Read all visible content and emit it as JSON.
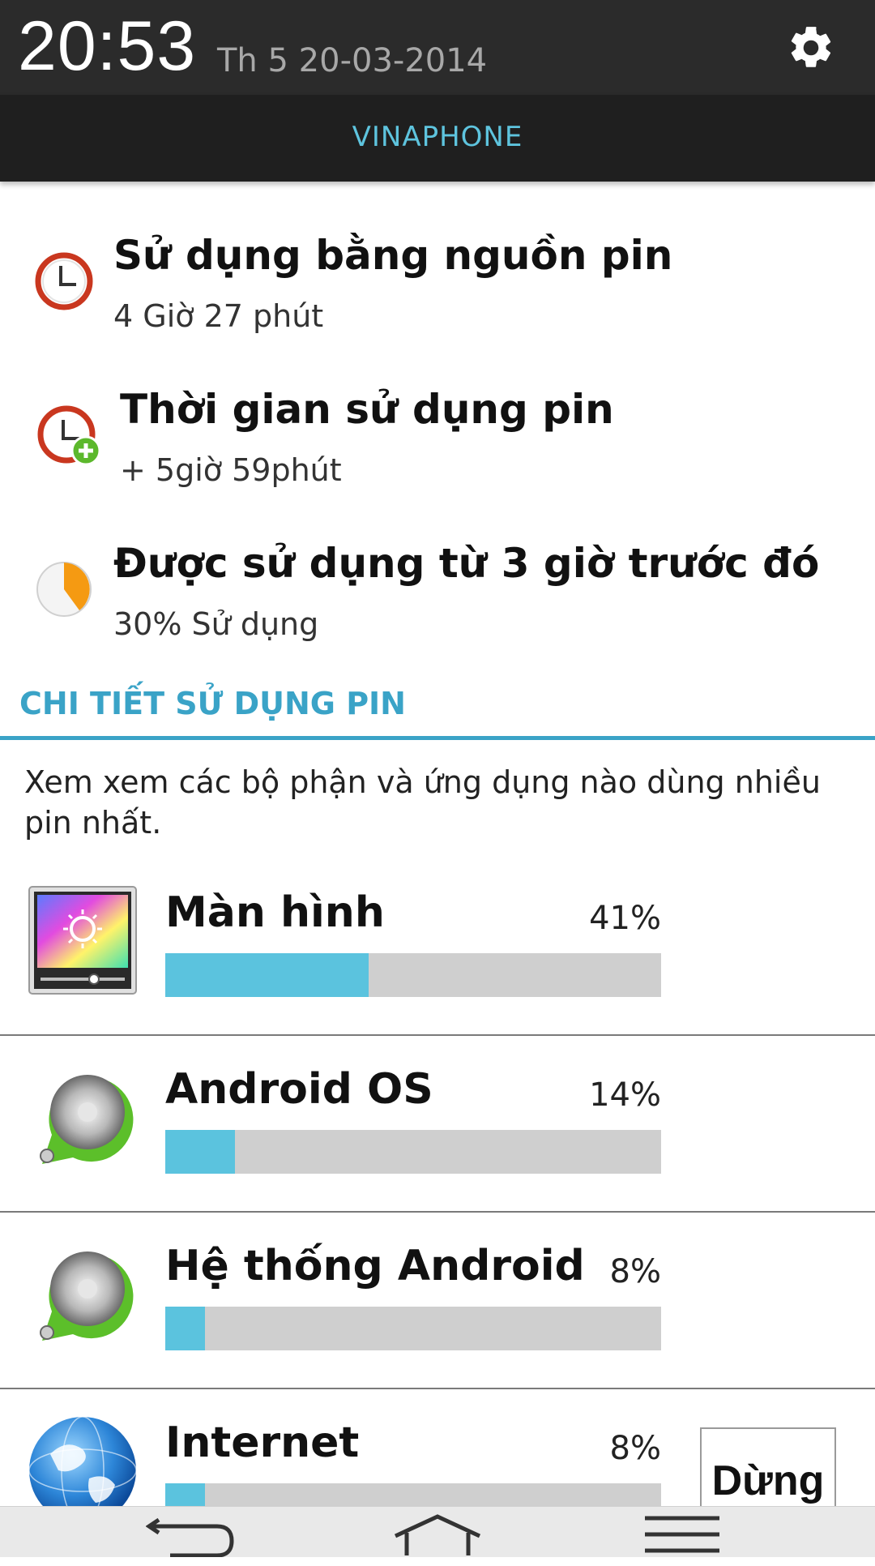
{
  "status": {
    "time": "20:53",
    "date": "Th 5 20-03-2014",
    "carrier": "VINAPHONE"
  },
  "summary": [
    {
      "title": "Sử dụng bằng nguồn pin",
      "subtitle": "4 Giờ 27 phút"
    },
    {
      "title": "Thời gian sử dụng pin",
      "subtitle": "+ 5giờ 59phút"
    },
    {
      "title": "Được sử dụng từ 3 giờ trước đó",
      "subtitle": "30% Sử dụng"
    }
  ],
  "section": {
    "title": "CHI TIẾT SỬ DỤNG PIN",
    "description": "Xem xem các bộ phận và ứng dụng nào dùng nhiều pin nhất."
  },
  "usage": [
    {
      "name": "Màn hình",
      "percent_label": "41%",
      "percent": 41,
      "icon": "display-icon"
    },
    {
      "name": "Android OS",
      "percent_label": "14%",
      "percent": 14,
      "icon": "android-os-icon"
    },
    {
      "name": "Hệ thống Android",
      "percent_label": "8%",
      "percent": 8,
      "icon": "android-system-icon"
    },
    {
      "name": "Internet",
      "percent_label": "8%",
      "percent": 8,
      "icon": "globe-icon"
    }
  ],
  "stop_button_label": "Dừng",
  "colors": {
    "accent": "#3aa3c7",
    "bar_fill": "#5bc3de",
    "bar_track": "#cfcfcf",
    "header_bg": "#2b2b2b"
  },
  "nav": {
    "icons": [
      "back-icon",
      "home-icon",
      "menu-icon"
    ]
  }
}
